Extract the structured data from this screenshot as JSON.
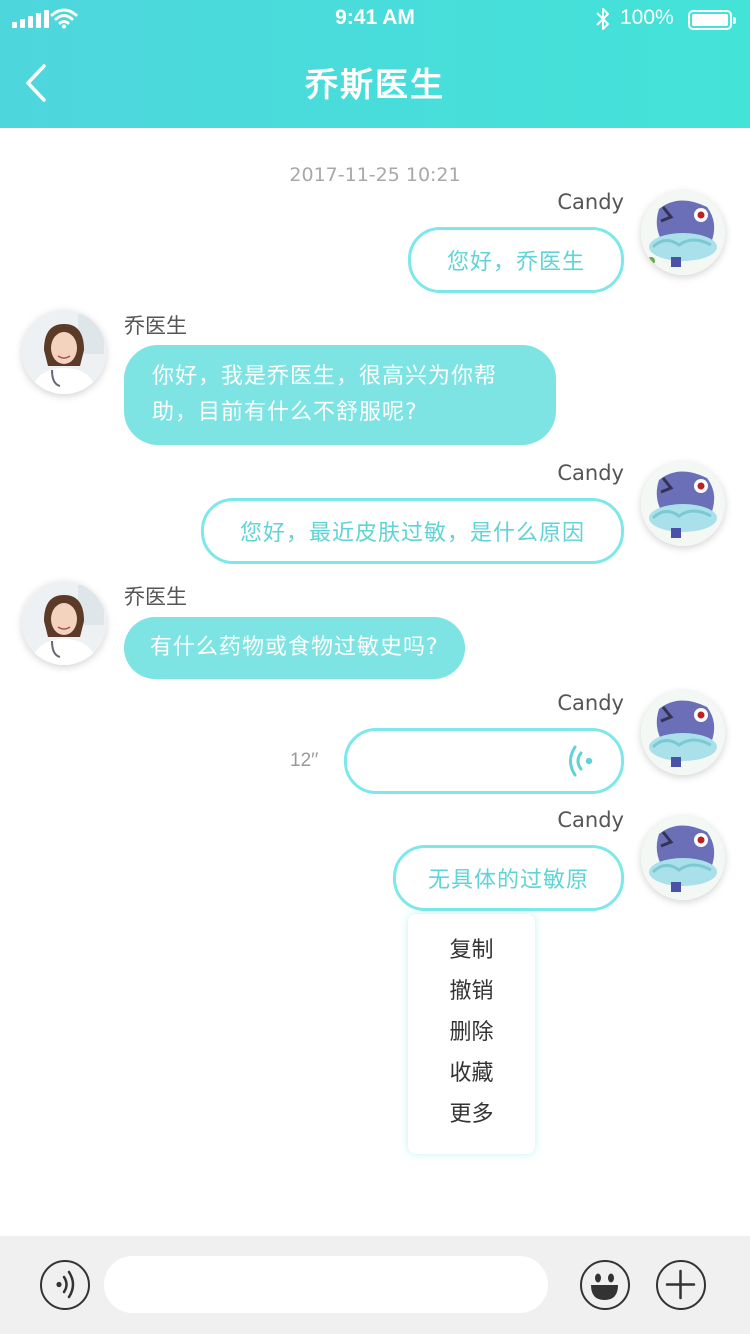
{
  "status_bar": {
    "time": "9:41 AM",
    "battery": "100%"
  },
  "header": {
    "title": "乔斯医生"
  },
  "chat": {
    "timestamp": "2017-11-25  10:21",
    "messages": [
      {
        "sender": "Candy",
        "text": "您好，乔医生"
      },
      {
        "sender": "乔医生",
        "text": "你好，我是乔医生，很高兴为你帮助，目前有什么不舒服呢?"
      },
      {
        "sender": "Candy",
        "text": "您好，最近皮肤过敏，是什么原因"
      },
      {
        "sender": "乔医生",
        "text": "有什么药物或食物过敏史吗?"
      },
      {
        "sender": "Candy",
        "duration": "12′′"
      },
      {
        "sender": "Candy",
        "text": "无具体的过敏原"
      }
    ]
  },
  "context_menu": {
    "items": [
      "复制",
      "撤销",
      "删除",
      "收藏",
      "更多"
    ]
  },
  "input_bar": {
    "placeholder": ""
  },
  "colors": {
    "accent": "#4ed6dd",
    "bubble_in": "#7ee4e3",
    "bubble_out_border": "#7de8ea"
  }
}
